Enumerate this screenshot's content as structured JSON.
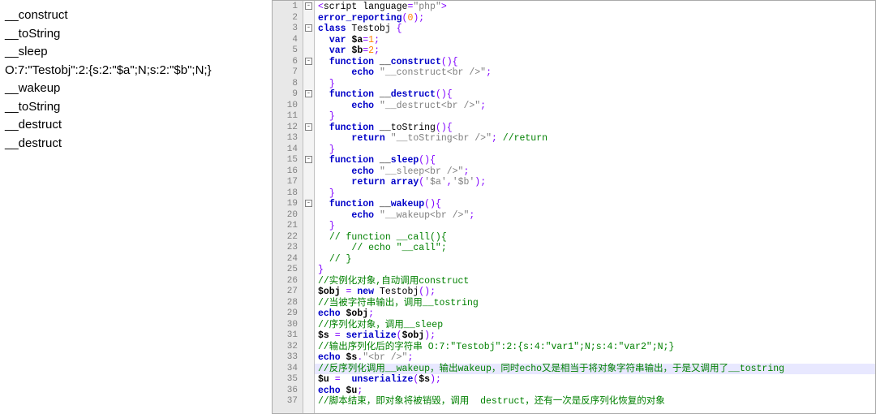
{
  "output": {
    "lines": [
      "__construct",
      "__toString",
      "__sleep",
      "O:7:\"Testobj\":2:{s:2:\"$a\";N;s:2:\"$b\";N;}",
      "__wakeup",
      "__toString",
      "__destruct",
      "__destruct"
    ]
  },
  "editor": {
    "highlighted_line": 34,
    "lines": [
      {
        "n": 1,
        "fold": "open",
        "tokens": [
          [
            "op",
            "<"
          ],
          [
            "tag",
            "script "
          ],
          [
            "attr",
            "language"
          ],
          [
            "op",
            "="
          ],
          [
            "str",
            "\"php\""
          ],
          [
            "op",
            ">"
          ]
        ]
      },
      {
        "n": 2,
        "tokens": [
          [
            "kw",
            "error_reporting"
          ],
          [
            "op",
            "("
          ],
          [
            "num",
            "0"
          ],
          [
            "op",
            ");"
          ]
        ]
      },
      {
        "n": 3,
        "fold": "open",
        "tokens": [
          [
            "kw",
            "class"
          ],
          [
            "fn",
            " Testobj"
          ],
          [
            "op",
            " {"
          ]
        ]
      },
      {
        "n": 4,
        "tokens": [
          [
            "fn",
            "  "
          ],
          [
            "kw",
            "var"
          ],
          [
            "fn",
            " "
          ],
          [
            "var",
            "$a"
          ],
          [
            "op",
            "="
          ],
          [
            "num",
            "1"
          ],
          [
            "op",
            ";"
          ]
        ]
      },
      {
        "n": 5,
        "tokens": [
          [
            "fn",
            "  "
          ],
          [
            "kw",
            "var"
          ],
          [
            "fn",
            " "
          ],
          [
            "var",
            "$b"
          ],
          [
            "op",
            "="
          ],
          [
            "num",
            "2"
          ],
          [
            "op",
            ";"
          ]
        ]
      },
      {
        "n": 6,
        "fold": "open",
        "tokens": [
          [
            "fn",
            "  "
          ],
          [
            "kw",
            "function"
          ],
          [
            "fn",
            " __"
          ],
          [
            "kw",
            "construct"
          ],
          [
            "op",
            "(){"
          ]
        ]
      },
      {
        "n": 7,
        "tokens": [
          [
            "fn",
            "      "
          ],
          [
            "kw",
            "echo"
          ],
          [
            "fn",
            " "
          ],
          [
            "str",
            "\"__construct<br />\""
          ],
          [
            "op",
            ";"
          ]
        ]
      },
      {
        "n": 8,
        "tokens": [
          [
            "fn",
            "  "
          ],
          [
            "op",
            "}"
          ]
        ]
      },
      {
        "n": 9,
        "fold": "open",
        "tokens": [
          [
            "fn",
            "  "
          ],
          [
            "kw",
            "function"
          ],
          [
            "fn",
            " __"
          ],
          [
            "kw",
            "destruct"
          ],
          [
            "op",
            "(){"
          ]
        ]
      },
      {
        "n": 10,
        "tokens": [
          [
            "fn",
            "      "
          ],
          [
            "kw",
            "echo"
          ],
          [
            "fn",
            " "
          ],
          [
            "str",
            "\"__destruct<br />\""
          ],
          [
            "op",
            ";"
          ]
        ]
      },
      {
        "n": 11,
        "tokens": [
          [
            "fn",
            "  "
          ],
          [
            "op",
            "}"
          ]
        ]
      },
      {
        "n": 12,
        "fold": "open",
        "tokens": [
          [
            "fn",
            "  "
          ],
          [
            "kw",
            "function"
          ],
          [
            "fn",
            " __toString"
          ],
          [
            "op",
            "(){"
          ]
        ]
      },
      {
        "n": 13,
        "tokens": [
          [
            "fn",
            "      "
          ],
          [
            "kw",
            "return"
          ],
          [
            "fn",
            " "
          ],
          [
            "str",
            "\"__toString<br />\""
          ],
          [
            "op",
            ";"
          ],
          [
            "fn",
            " "
          ],
          [
            "cm",
            "//return"
          ]
        ]
      },
      {
        "n": 14,
        "tokens": [
          [
            "fn",
            "  "
          ],
          [
            "op",
            "}"
          ]
        ]
      },
      {
        "n": 15,
        "fold": "open",
        "tokens": [
          [
            "fn",
            "  "
          ],
          [
            "kw",
            "function"
          ],
          [
            "fn",
            " __"
          ],
          [
            "kw",
            "sleep"
          ],
          [
            "op",
            "(){"
          ]
        ]
      },
      {
        "n": 16,
        "tokens": [
          [
            "fn",
            "      "
          ],
          [
            "kw",
            "echo"
          ],
          [
            "fn",
            " "
          ],
          [
            "str",
            "\"__sleep<br />\""
          ],
          [
            "op",
            ";"
          ]
        ]
      },
      {
        "n": 17,
        "tokens": [
          [
            "fn",
            "      "
          ],
          [
            "kw",
            "return"
          ],
          [
            "fn",
            " "
          ],
          [
            "kw",
            "array"
          ],
          [
            "op",
            "("
          ],
          [
            "str",
            "'$a'"
          ],
          [
            "op",
            ","
          ],
          [
            "str",
            "'$b'"
          ],
          [
            "op",
            ");"
          ]
        ]
      },
      {
        "n": 18,
        "tokens": [
          [
            "fn",
            "  "
          ],
          [
            "op",
            "}"
          ]
        ]
      },
      {
        "n": 19,
        "fold": "open",
        "tokens": [
          [
            "fn",
            "  "
          ],
          [
            "kw",
            "function"
          ],
          [
            "fn",
            " __"
          ],
          [
            "kw",
            "wakeup"
          ],
          [
            "op",
            "(){"
          ]
        ]
      },
      {
        "n": 20,
        "tokens": [
          [
            "fn",
            "      "
          ],
          [
            "kw",
            "echo"
          ],
          [
            "fn",
            " "
          ],
          [
            "str",
            "\"__wakeup<br />\""
          ],
          [
            "op",
            ";"
          ]
        ]
      },
      {
        "n": 21,
        "tokens": [
          [
            "fn",
            "  "
          ],
          [
            "op",
            "}"
          ]
        ]
      },
      {
        "n": 22,
        "tokens": [
          [
            "fn",
            "  "
          ],
          [
            "cm",
            "// function __call(){"
          ]
        ]
      },
      {
        "n": 23,
        "tokens": [
          [
            "fn",
            "  "
          ],
          [
            "cm",
            "    // echo \"__call\";"
          ]
        ]
      },
      {
        "n": 24,
        "tokens": [
          [
            "fn",
            "  "
          ],
          [
            "cm",
            "// }"
          ]
        ]
      },
      {
        "n": 25,
        "tokens": [
          [
            "op",
            "}"
          ]
        ]
      },
      {
        "n": 26,
        "tokens": [
          [
            "cm",
            "//实例化对象,自动调用construct"
          ]
        ]
      },
      {
        "n": 27,
        "tokens": [
          [
            "var",
            "$obj"
          ],
          [
            "fn",
            " "
          ],
          [
            "op",
            "="
          ],
          [
            "fn",
            " "
          ],
          [
            "kw",
            "new"
          ],
          [
            "fn",
            " Testobj"
          ],
          [
            "op",
            "();"
          ]
        ]
      },
      {
        "n": 28,
        "tokens": [
          [
            "cm",
            "//当被字符串输出，调用__tostring"
          ]
        ]
      },
      {
        "n": 29,
        "tokens": [
          [
            "kw",
            "echo"
          ],
          [
            "fn",
            " "
          ],
          [
            "var",
            "$obj"
          ],
          [
            "op",
            ";"
          ]
        ]
      },
      {
        "n": 30,
        "tokens": [
          [
            "cm",
            "//序列化对象，调用__sleep"
          ]
        ]
      },
      {
        "n": 31,
        "tokens": [
          [
            "var",
            "$s"
          ],
          [
            "fn",
            " "
          ],
          [
            "op",
            "="
          ],
          [
            "fn",
            " "
          ],
          [
            "kw",
            "serialize"
          ],
          [
            "op",
            "("
          ],
          [
            "var",
            "$obj"
          ],
          [
            "op",
            ");"
          ]
        ]
      },
      {
        "n": 32,
        "tokens": [
          [
            "cm",
            "//输出序列化后的字符串 O:7:\"Testobj\":2:{s:4:\"var1\";N;s:4:\"var2\";N;}"
          ]
        ]
      },
      {
        "n": 33,
        "tokens": [
          [
            "kw",
            "echo"
          ],
          [
            "fn",
            " "
          ],
          [
            "var",
            "$s"
          ],
          [
            "op",
            "."
          ],
          [
            "str",
            "\"<br />\""
          ],
          [
            "op",
            ";"
          ]
        ]
      },
      {
        "n": 34,
        "tokens": [
          [
            "cm",
            "//反序列化调用__wakeup，输出wakeup，同时echo又是相当于将对象字符串输出，于是又调用了__tostring"
          ]
        ]
      },
      {
        "n": 35,
        "tokens": [
          [
            "var",
            "$u"
          ],
          [
            "fn",
            " "
          ],
          [
            "op",
            "="
          ],
          [
            "fn",
            "  "
          ],
          [
            "kw",
            "unserialize"
          ],
          [
            "op",
            "("
          ],
          [
            "var",
            "$s"
          ],
          [
            "op",
            ");"
          ]
        ]
      },
      {
        "n": 36,
        "tokens": [
          [
            "kw",
            "echo"
          ],
          [
            "fn",
            " "
          ],
          [
            "var",
            "$u"
          ],
          [
            "op",
            ";"
          ]
        ]
      },
      {
        "n": 37,
        "tokens": [
          [
            "cm",
            "//脚本结束，即对象将被销毁，调用  destruct，还有一次是反序列化恢复的对象"
          ]
        ]
      }
    ]
  }
}
